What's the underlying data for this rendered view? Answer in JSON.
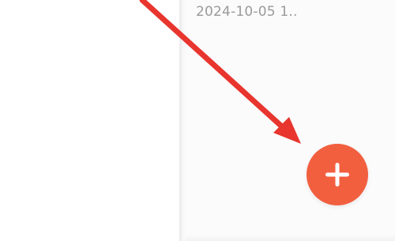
{
  "note_list": {
    "items": [
      {
        "timestamp": "2024-10-05 1.."
      }
    ]
  },
  "fab": {
    "icon": "plus-icon",
    "color": "#f25f3f"
  },
  "annotation": {
    "icon": "arrow-pointer",
    "color": "#e8352e"
  }
}
